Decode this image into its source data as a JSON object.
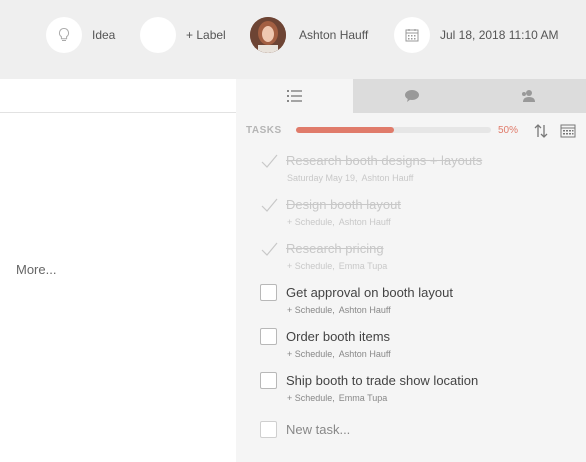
{
  "header": {
    "idea_label": "Idea",
    "label_button": "+ Label",
    "assignee_name": "Ashton Hauff",
    "due_date": "Jul 18, 2018 11:10 AM"
  },
  "left": {
    "more_link": "More..."
  },
  "tabs": [
    {
      "icon": "list-icon",
      "active": true
    },
    {
      "icon": "comment-icon",
      "active": false
    },
    {
      "icon": "people-icon",
      "active": false
    }
  ],
  "tasks_panel": {
    "title": "TASKS",
    "progress_percent": 50,
    "progress_label": "50%"
  },
  "tasks": [
    {
      "title": "Research booth designs + layouts",
      "date": "Saturday May 19,",
      "assignee": "Ashton Hauff",
      "done": true
    },
    {
      "title": "Design booth layout",
      "date": "+ Schedule,",
      "assignee": "Ashton Hauff",
      "done": true
    },
    {
      "title": "Research pricing",
      "date": "+ Schedule,",
      "assignee": "Emma Tupa",
      "done": true
    },
    {
      "title": "Get approval on booth layout",
      "date": "+ Schedule,",
      "assignee": "Ashton Hauff",
      "done": false
    },
    {
      "title": "Order booth items",
      "date": "+ Schedule,",
      "assignee": "Ashton Hauff",
      "done": false
    },
    {
      "title": "Ship booth to trade show location",
      "date": "+ Schedule,",
      "assignee": "Emma Tupa",
      "done": false
    }
  ],
  "new_task_placeholder": "New task...",
  "colors": {
    "accent": "#e07b6a",
    "topbar_bg": "#efefef",
    "panel_bg": "#f5f5f5"
  }
}
